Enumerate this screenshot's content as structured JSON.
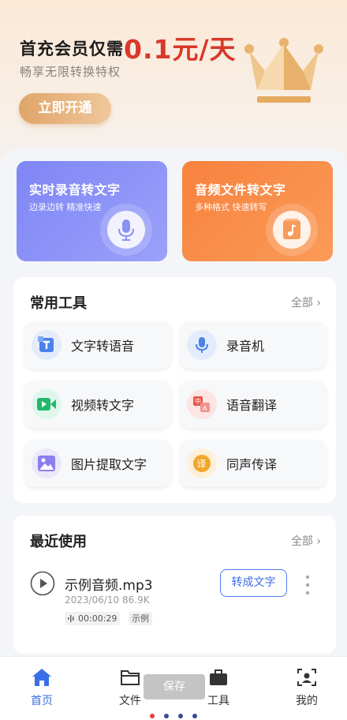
{
  "promo": {
    "title": "首充会员仅需",
    "price": "0.1元/天",
    "subtitle": "畅享无限转换特权",
    "cta_label": "立即开通"
  },
  "feature_cards": [
    {
      "title": "实时录音转文字",
      "subtitle": "边录边转  精准快速",
      "icon": "microphone-icon"
    },
    {
      "title": "音频文件转文字",
      "subtitle": "多种格式  快速转写",
      "icon": "music-file-icon"
    }
  ],
  "tools": {
    "title": "常用工具",
    "all_label": "全部",
    "items": [
      {
        "label": "文字转语音",
        "icon": "text-to-speech-icon"
      },
      {
        "label": "录音机",
        "icon": "recorder-mic-icon"
      },
      {
        "label": "视频转文字",
        "icon": "video-camera-icon"
      },
      {
        "label": "语音翻译",
        "icon": "translate-icon"
      },
      {
        "label": "图片提取文字",
        "icon": "image-icon"
      },
      {
        "label": "同声传译",
        "icon": "interpret-icon"
      }
    ]
  },
  "recent": {
    "title": "最近使用",
    "all_label": "全部",
    "item": {
      "name": "示例音频.mp3",
      "meta": "2023/06/10 86.9K",
      "duration": "00:00:29",
      "tag": "示例",
      "action_label": "转成文字"
    }
  },
  "tabbar": {
    "items": [
      {
        "label": "首页",
        "icon": "home-icon",
        "active": true
      },
      {
        "label": "文件",
        "icon": "folder-icon",
        "active": false
      },
      {
        "label": "工具",
        "icon": "toolbox-icon",
        "active": false
      },
      {
        "label": "我的",
        "icon": "profile-icon",
        "active": false
      }
    ]
  },
  "toast": "保存",
  "colors": {
    "accent": "#3b6fe8",
    "price": "#d9382a",
    "card_blue": "#7f86f6",
    "card_orange": "#f7823e"
  }
}
